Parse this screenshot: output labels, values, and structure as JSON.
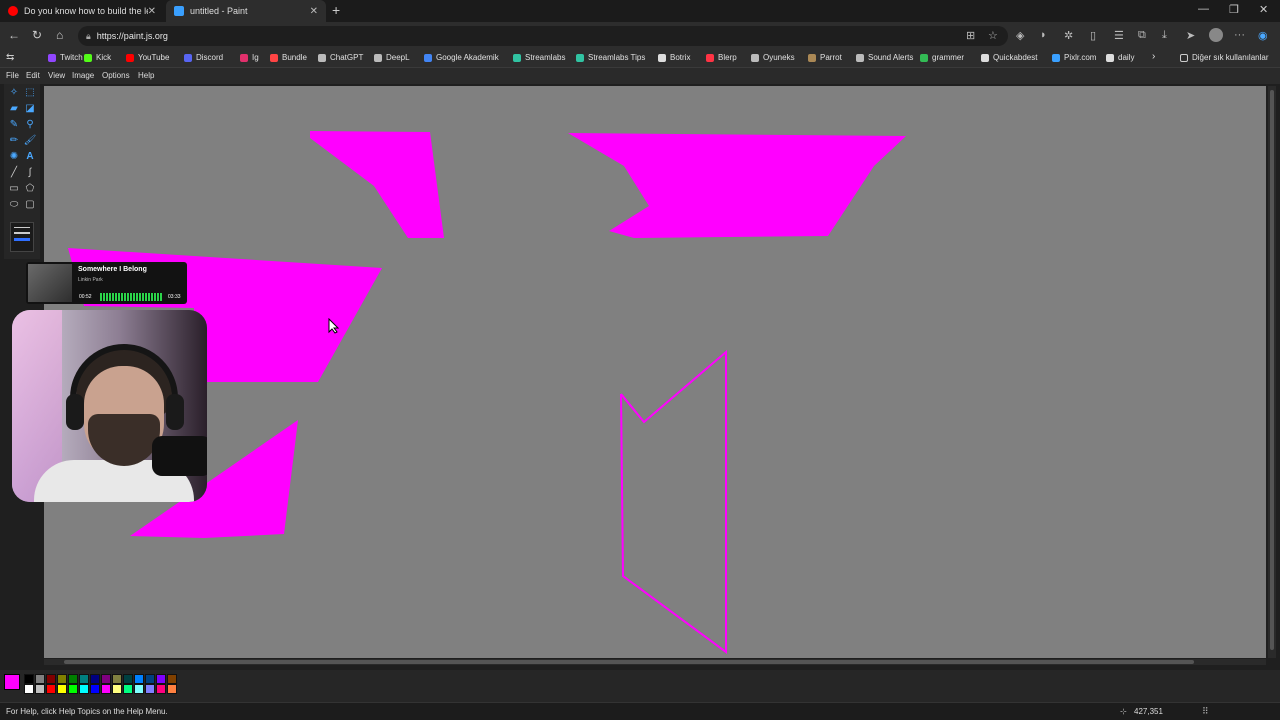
{
  "browser": {
    "tabs": [
      {
        "title": "Do you know how to build the let",
        "favicon_color": "#ff0000",
        "active": false
      },
      {
        "title": "untitled - Paint",
        "favicon_color": "#3aa0ff",
        "active": true
      }
    ],
    "new_tab_label": "+",
    "url": "https://paint.js.org",
    "window_controls": {
      "minimize": "—",
      "restore": "❐",
      "close": "✕"
    }
  },
  "bookmarks": [
    {
      "label": "Twitch",
      "color": "#9146ff"
    },
    {
      "label": "Kick",
      "color": "#53fc18"
    },
    {
      "label": "YouTube",
      "color": "#ff0000"
    },
    {
      "label": "Discord",
      "color": "#5865f2"
    },
    {
      "label": "Ig",
      "color": "#e1306c"
    },
    {
      "label": "Bundle",
      "color": "#ff4444"
    },
    {
      "label": "ChatGPT",
      "color": "#bbbbbb"
    },
    {
      "label": "DeepL",
      "color": "#bbbbbb"
    },
    {
      "label": "Google Akademik",
      "color": "#4285f4"
    },
    {
      "label": "Streamlabs",
      "color": "#31c3a2"
    },
    {
      "label": "Streamlabs Tips",
      "color": "#31c3a2"
    },
    {
      "label": "Botrix",
      "color": "#dddddd"
    },
    {
      "label": "Blerp",
      "color": "#ff3344"
    },
    {
      "label": "Oyuneks",
      "color": "#bbbbbb"
    },
    {
      "label": "Parrot",
      "color": "#aa8855"
    },
    {
      "label": "Sound Alerts",
      "color": "#bbbbbb"
    },
    {
      "label": "grammer",
      "color": "#33bb55"
    },
    {
      "label": "Quickabdest",
      "color": "#dddddd"
    },
    {
      "label": "Pixlr.com",
      "color": "#3aa0ff"
    },
    {
      "label": "daily",
      "color": "#dddddd"
    }
  ],
  "bookmarks_overflow_label": "›",
  "bookmarks_other_label": "Diğer sık kullanılanlar",
  "paint": {
    "menu": [
      "File",
      "Edit",
      "View",
      "Image",
      "Options",
      "Help"
    ],
    "status_text": "For Help, click Help Topics on the Help Menu.",
    "coordinates": "427,351",
    "current_color": "#ff00ff",
    "palette": [
      "#000000",
      "#808080",
      "#800000",
      "#808000",
      "#008000",
      "#008080",
      "#000080",
      "#800080",
      "#808040",
      "#004040",
      "#0080ff",
      "#004080",
      "#8000ff",
      "#804000",
      "#ffffff",
      "#c0c0c0",
      "#ff0000",
      "#ffff00",
      "#00ff00",
      "#00ffff",
      "#0000ff",
      "#ff00ff",
      "#ffff80",
      "#00ff80",
      "#80ffff",
      "#8080ff",
      "#ff0080",
      "#ff8040"
    ],
    "drawing": {
      "stroke_color": "#ff00ff"
    }
  },
  "music_widget": {
    "song": "Somewhere I Belong",
    "artist": "Linkin Park",
    "elapsed": "00:52",
    "duration": "03:33"
  }
}
